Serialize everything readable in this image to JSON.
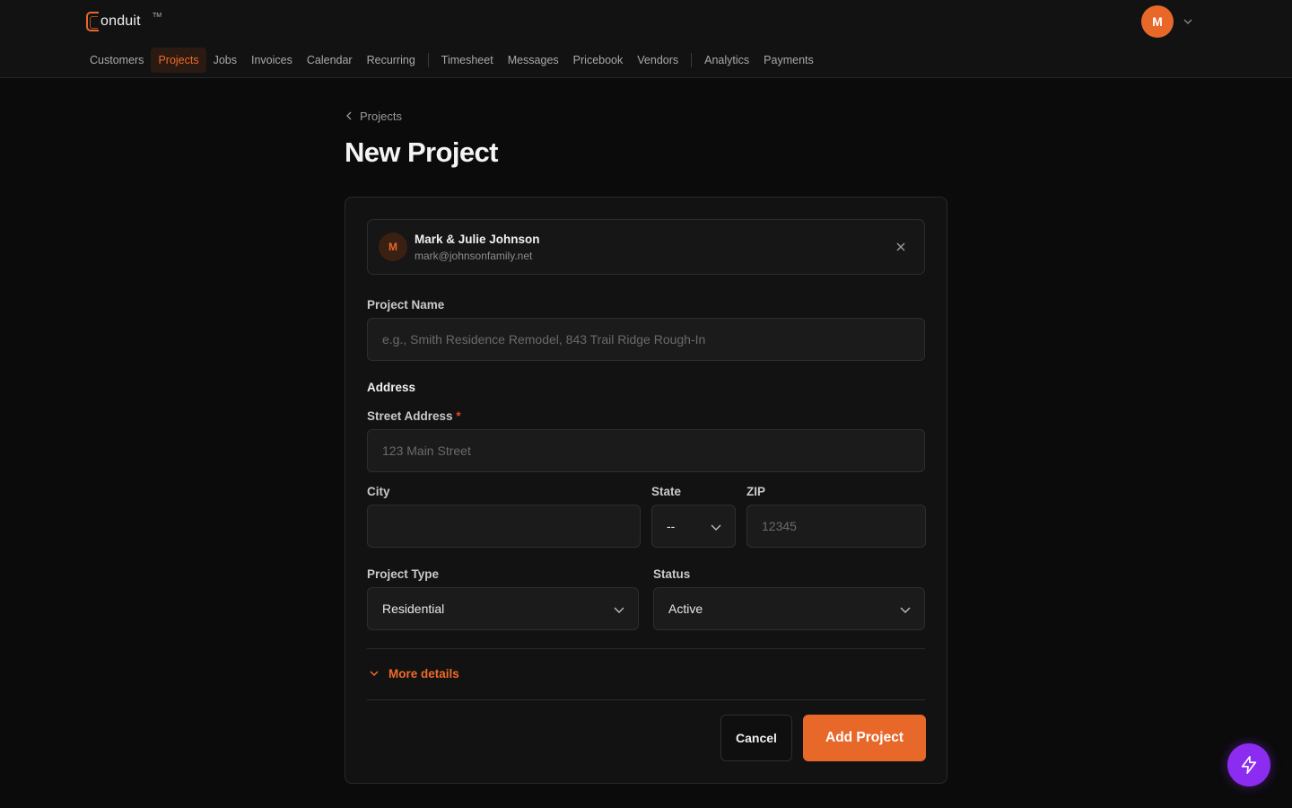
{
  "brand": {
    "name": "onduit",
    "trademark": "TM",
    "accent": "#e8682a"
  },
  "user": {
    "initial": "M"
  },
  "nav": {
    "items": [
      "Customers",
      "Projects",
      "Jobs",
      "Invoices",
      "Calendar",
      "Recurring",
      "Timesheet",
      "Messages",
      "Pricebook",
      "Vendors",
      "Analytics",
      "Payments"
    ],
    "active": "Projects"
  },
  "breadcrumb": {
    "label": "Projects"
  },
  "page": {
    "title": "New Project"
  },
  "customer": {
    "initial": "M",
    "name": "Mark & Julie Johnson",
    "email": "mark@johnsonfamily.net"
  },
  "form": {
    "project_name": {
      "label": "Project Name",
      "placeholder": "e.g., Smith Residence Remodel, 843 Trail Ridge Rough-In",
      "value": ""
    },
    "address_section": "Address",
    "street": {
      "label": "Street Address",
      "required_mark": "*",
      "placeholder": "123 Main Street",
      "value": ""
    },
    "city": {
      "label": "City",
      "value": ""
    },
    "state": {
      "label": "State",
      "value": "--"
    },
    "zip": {
      "label": "ZIP",
      "placeholder": "12345",
      "value": ""
    },
    "project_type": {
      "label": "Project Type",
      "value": "Residential"
    },
    "status": {
      "label": "Status",
      "value": "Active"
    },
    "more_details": "More details"
  },
  "actions": {
    "cancel": "Cancel",
    "submit": "Add Project"
  },
  "colors": {
    "fab": "#8b2cf0",
    "required": "#e8442a"
  }
}
